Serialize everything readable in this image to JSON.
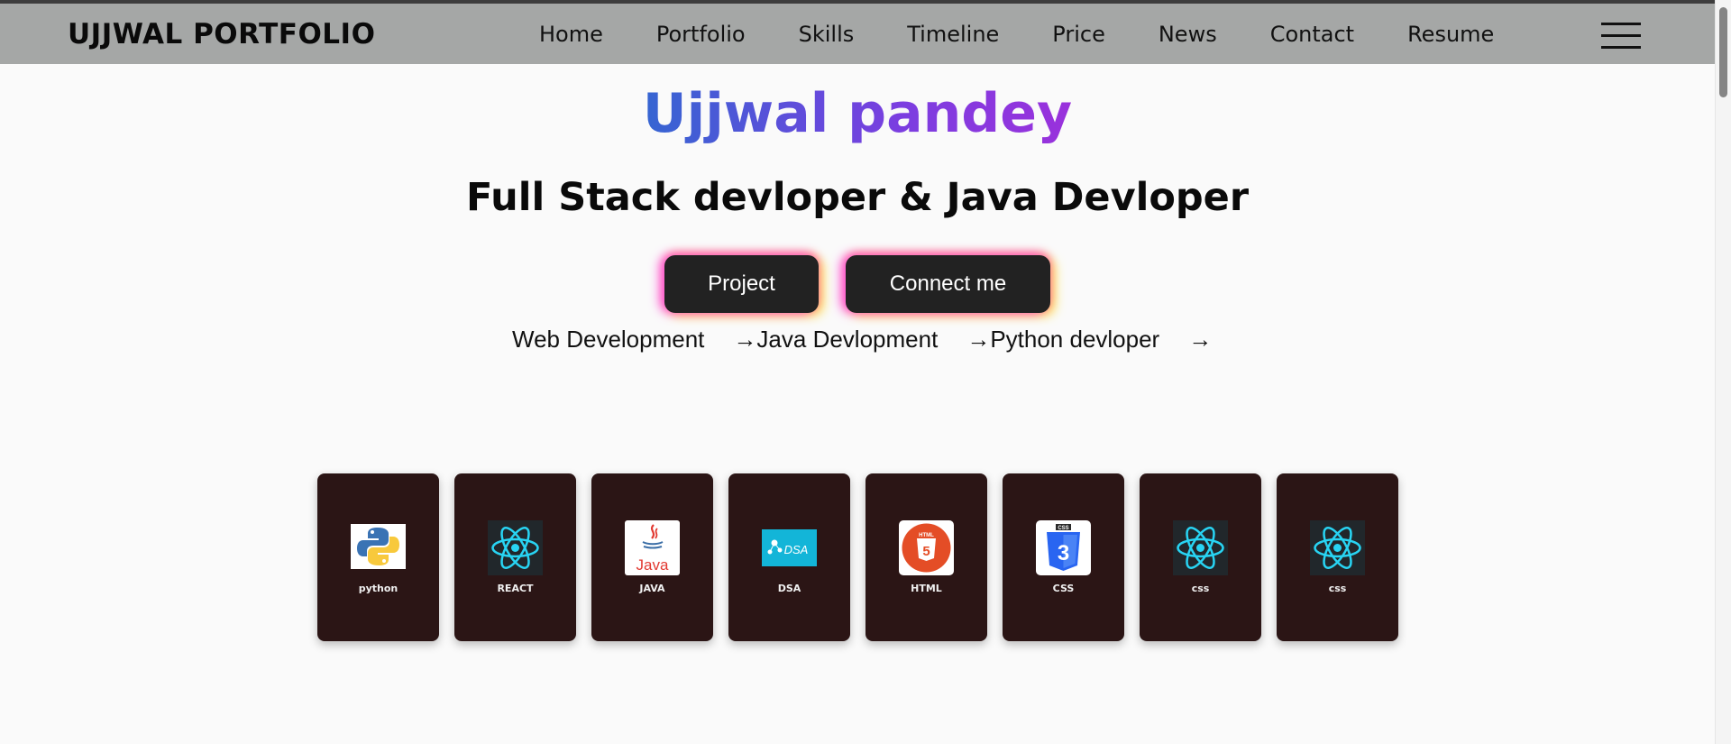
{
  "nav": {
    "brand": "UJJWAL PORTFOLIO",
    "links": [
      "Home",
      "Portfolio",
      "Skills",
      "Timeline",
      "Price",
      "News",
      "Contact",
      "Resume"
    ],
    "menu_icon": "hamburger-icon"
  },
  "hero": {
    "name": "Ujjwal pandey",
    "subtitle": "Full Stack devloper & Java Devloper",
    "buttons": {
      "project": "Project",
      "connect": "Connect me"
    },
    "roles": [
      "Web Development",
      "Java Devlopment",
      "Python devloper"
    ],
    "arrow": "→"
  },
  "skills": [
    {
      "label": "python",
      "icon": "python-icon"
    },
    {
      "label": "REACT",
      "icon": "react-icon"
    },
    {
      "label": "JAVA",
      "icon": "java-icon"
    },
    {
      "label": "DSA",
      "icon": "dsa-icon"
    },
    {
      "label": "HTML",
      "icon": "html5-icon"
    },
    {
      "label": "CSS",
      "icon": "css3-icon"
    },
    {
      "label": "css",
      "icon": "react-icon"
    },
    {
      "label": "css",
      "icon": "react-icon"
    }
  ],
  "colors": {
    "navbar": "#a5a7a6",
    "name_gradient_start": "#3565d2",
    "name_gradient_end": "#9a31dc",
    "button_bg": "#222222",
    "card_bg": "#2b1515"
  }
}
